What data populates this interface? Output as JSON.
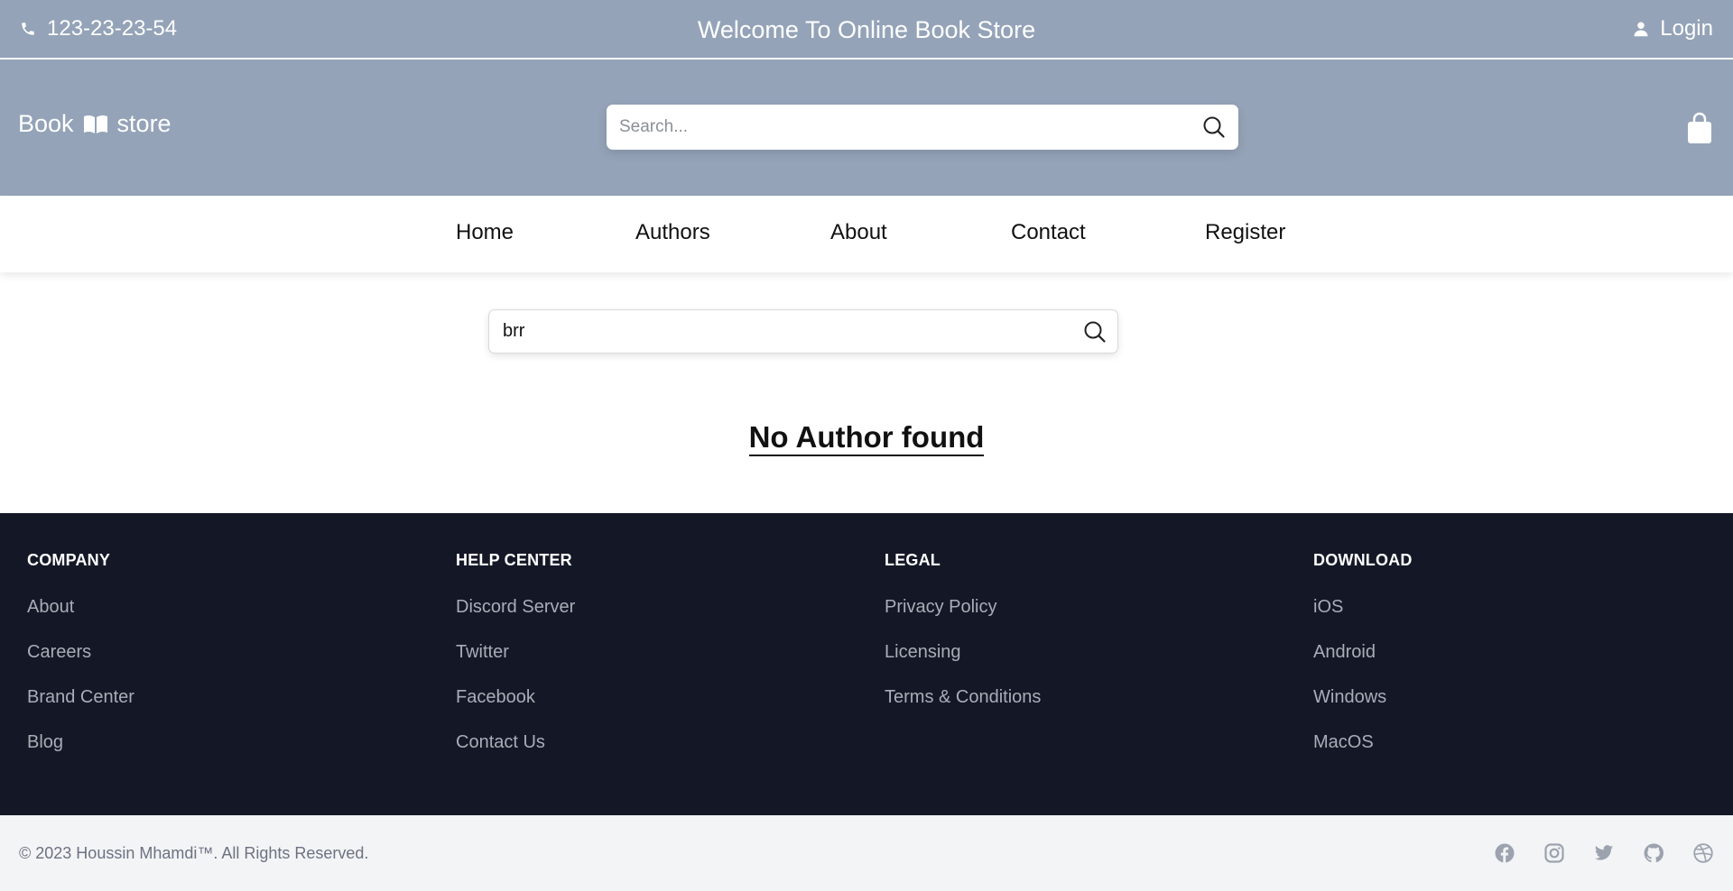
{
  "topbar": {
    "phone": "123-23-23-54",
    "welcome": "Welcome To Online Book Store",
    "login": "Login"
  },
  "header": {
    "logo_left": "Book",
    "logo_right": "store",
    "search_placeholder": "Search..."
  },
  "nav": {
    "items": [
      {
        "label": "Home"
      },
      {
        "label": "Authors"
      },
      {
        "label": "About"
      },
      {
        "label": "Contact"
      },
      {
        "label": "Register"
      }
    ]
  },
  "author_search": {
    "value": "brr"
  },
  "message": "No Author found",
  "footer": {
    "columns": [
      {
        "title": "COMPANY",
        "links": [
          "About",
          "Careers",
          "Brand Center",
          "Blog"
        ]
      },
      {
        "title": "HELP CENTER",
        "links": [
          "Discord Server",
          "Twitter",
          "Facebook",
          "Contact Us"
        ]
      },
      {
        "title": "LEGAL",
        "links": [
          "Privacy Policy",
          "Licensing",
          "Terms & Conditions"
        ]
      },
      {
        "title": "DOWNLOAD",
        "links": [
          "iOS",
          "Android",
          "Windows",
          "MacOS"
        ]
      }
    ],
    "copyright": "© 2023 Houssin Mhamdi™. All Rights Reserved.",
    "social_icons": [
      "facebook-icon",
      "instagram-icon",
      "twitter-icon",
      "github-icon",
      "dribbble-icon"
    ]
  },
  "colors": {
    "header_bg": "#94a3b8",
    "footer_bg": "#141826",
    "bottom_bg": "#f3f4f6"
  }
}
